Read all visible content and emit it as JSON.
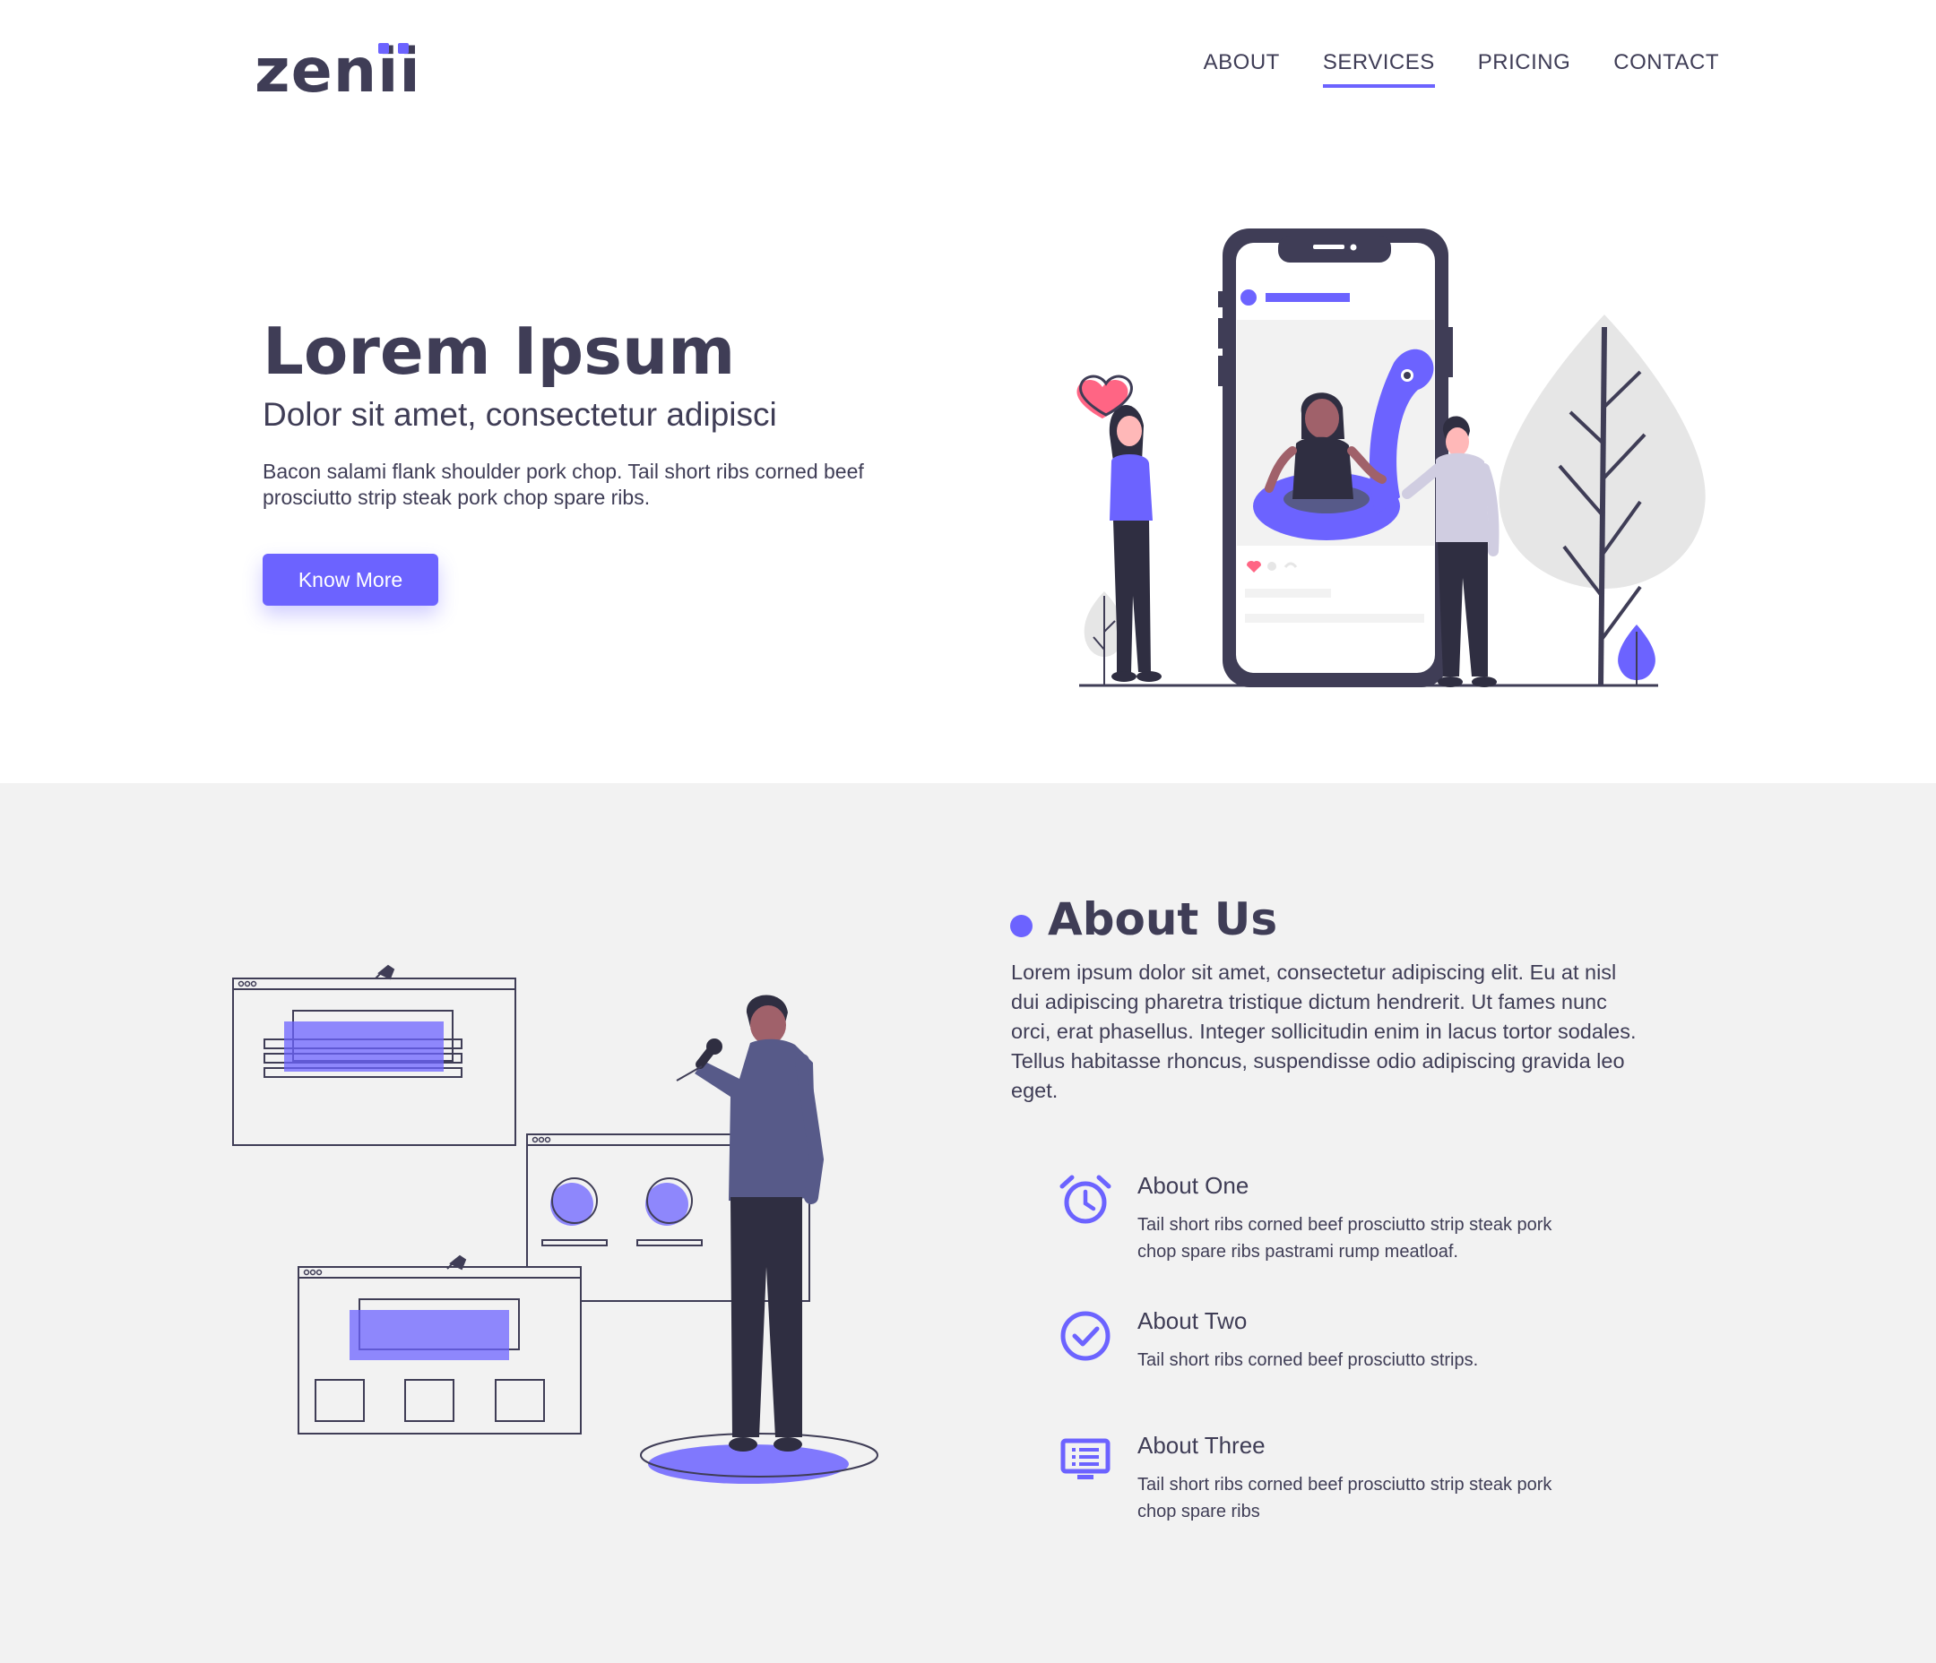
{
  "brand": {
    "logo": "zenii",
    "accent": "#6c63ff",
    "dark": "#3f3d56"
  },
  "nav": {
    "items": [
      {
        "label": "ABOUT",
        "active": false
      },
      {
        "label": "SERVICES",
        "active": true
      },
      {
        "label": "PRICING",
        "active": false
      },
      {
        "label": "CONTACT",
        "active": false
      }
    ]
  },
  "hero": {
    "title": "Lorem Ipsum",
    "subtitle": "Dolor sit amet, consectetur adipisci",
    "text": "Bacon salami flank shoulder pork chop. Tail short ribs corned beef prosciutto strip steak pork chop spare ribs.",
    "button_label": "Know More",
    "illustration": "social-media-phone-illustration"
  },
  "about": {
    "title": "About Us",
    "text": "Lorem ipsum dolor sit amet, consectetur adipiscing elit. Eu at nisl dui adipiscing pharetra tristique dictum hendrerit. Ut fames nunc orci, erat phasellus. Integer sollicitudin enim in lacus tortor sodales. Tellus habitasse rhoncus, suspendisse odio adipiscing gravida leo eget.",
    "illustration": "wireframe-board-illustration",
    "features": [
      {
        "icon": "alarm-clock-icon",
        "title": "About One",
        "text": "Tail short ribs corned beef prosciutto strip steak pork chop spare ribs pastrami rump meatloaf."
      },
      {
        "icon": "check-circle-icon",
        "title": "About Two",
        "text": "Tail short ribs corned beef prosciutto strips."
      },
      {
        "icon": "monitor-list-icon",
        "title": "About Three",
        "text": "Tail short ribs corned beef prosciutto strip steak pork chop spare ribs"
      }
    ]
  }
}
